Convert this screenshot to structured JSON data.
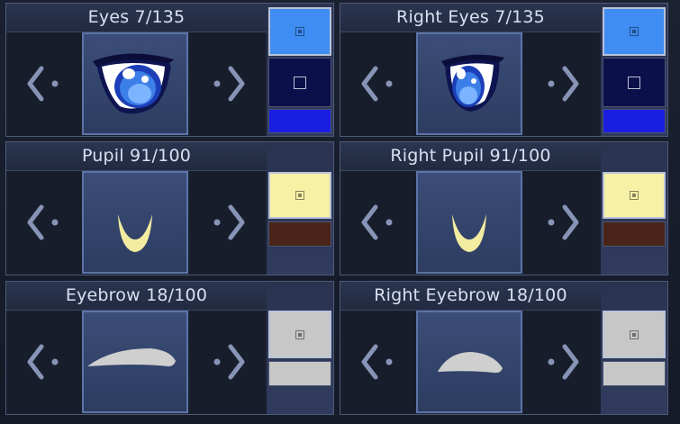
{
  "colors": {
    "panel_border": "#4d5a76",
    "title_text": "#d7e0f0",
    "arrow": "#8794b6",
    "preview_border": "#5b74a8"
  },
  "panels": [
    {
      "title": "Eyes 7/135",
      "preview_icon": "left-eye-icon",
      "swatches": [
        "#3f8cf2",
        "#0b0f4a",
        "#1a1ee0"
      ]
    },
    {
      "title": "Right Eyes 7/135",
      "preview_icon": "right-eye-icon",
      "swatches": [
        "#3f8cf2",
        "#0b0f4a",
        "#1a1ee0"
      ]
    },
    {
      "title": "Pupil 91/100",
      "preview_icon": "crescent-pupil-icon",
      "swatches": [
        "#f7f1a6",
        "#4a2418"
      ]
    },
    {
      "title": "Right Pupil 91/100",
      "preview_icon": "crescent-pupil-icon",
      "swatches": [
        "#f7f1a6",
        "#4a2418"
      ]
    },
    {
      "title": "Eyebrow 18/100",
      "preview_icon": "eyebrow-icon",
      "swatches": [
        "#c7c7c7",
        "#c7c7c7"
      ]
    },
    {
      "title": "Right Eyebrow 18/100",
      "preview_icon": "eyebrow-icon",
      "swatches": [
        "#c7c7c7",
        "#c7c7c7"
      ]
    }
  ]
}
